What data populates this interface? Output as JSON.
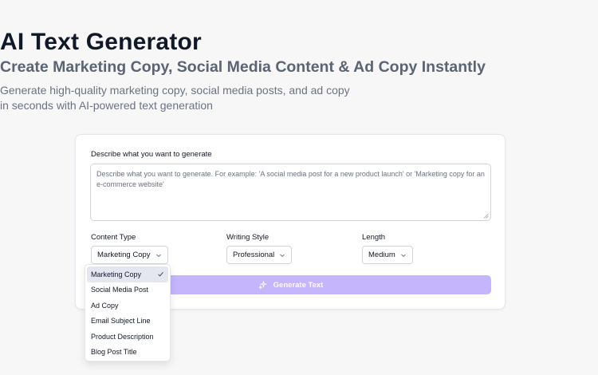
{
  "hero": {
    "title": "AI Text Generator",
    "subtitle": "Create Marketing Copy, Social Media Content & Ad Copy Instantly",
    "description_line1": "Generate high-quality marketing copy, social media posts, and ad copy",
    "description_line2": "in seconds with AI-powered text generation"
  },
  "form": {
    "prompt_label": "Describe what you want to generate",
    "prompt_placeholder": "Describe what you want to generate. For example: 'A social media post for a new product launch' or 'Marketing copy for an e-commerce website'",
    "prompt_value": "",
    "content_type": {
      "label": "Content Type",
      "value": "Marketing Copy"
    },
    "writing_style": {
      "label": "Writing Style",
      "value": "Professional"
    },
    "length": {
      "label": "Length",
      "value": "Medium"
    },
    "generate_label": "Generate Text",
    "generate_icon": "sparkles-icon"
  },
  "dropdown": {
    "options": [
      "Marketing Copy",
      "Social Media Post",
      "Ad Copy",
      "Email Subject Line",
      "Product Description",
      "Blog Post Title"
    ],
    "selected_index": 0
  },
  "colors": {
    "accent": "#c4b5fd",
    "text_primary": "#111827",
    "text_muted": "#6b7280"
  }
}
